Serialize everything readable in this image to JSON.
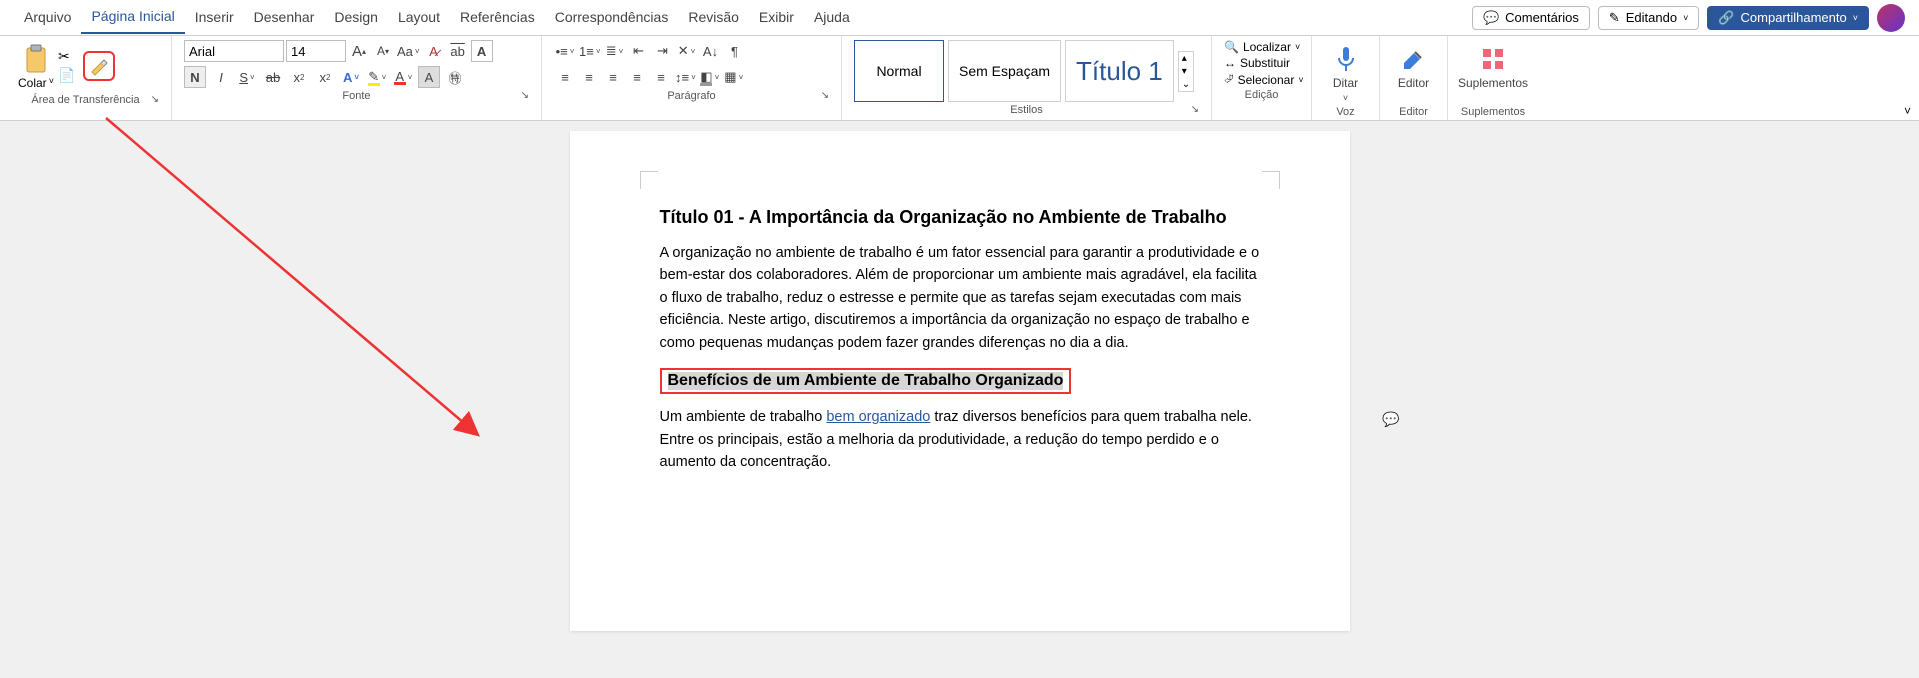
{
  "tabs": {
    "arquivo": "Arquivo",
    "inicio": "Página Inicial",
    "inserir": "Inserir",
    "desenhar": "Desenhar",
    "design": "Design",
    "layout": "Layout",
    "referencias": "Referências",
    "correspondencias": "Correspondências",
    "revisao": "Revisão",
    "exibir": "Exibir",
    "ajuda": "Ajuda"
  },
  "topright": {
    "comentarios": "Comentários",
    "editando": "Editando",
    "compartilhar": "Compartilhamento"
  },
  "groups": {
    "clipboard": "Área de Transferência",
    "font": "Fonte",
    "paragraph": "Parágrafo",
    "styles": "Estilos",
    "editing": "Edição",
    "voice": "Voz",
    "editor": "Editor",
    "addins": "Suplementos"
  },
  "clipboard": {
    "paste": "Colar"
  },
  "font": {
    "name": "Arial",
    "size": "14",
    "bold": "N",
    "italic": "I",
    "strike": "S",
    "sub": "x",
    "sup": "x"
  },
  "styles": {
    "normal": "Normal",
    "nosp": "Sem Espaçam",
    "t1": "Título 1"
  },
  "editing": {
    "find": "Localizar",
    "replace": "Substituir",
    "select": "Selecionar"
  },
  "voice": {
    "dictate": "Ditar"
  },
  "editor": {
    "label": "Editor"
  },
  "addins": {
    "label": "Suplementos"
  },
  "doc": {
    "h1": "Título 01 - A Importância da Organização no Ambiente de Trabalho",
    "p1": "A organização no ambiente de trabalho é um fator essencial para garantir a produtividade e o bem-estar dos colaboradores. Além de proporcionar um ambiente mais agradável, ela facilita o fluxo de trabalho, reduz o estresse e permite que as tarefas sejam executadas com mais eficiência. Neste artigo, discutiremos a importância da organização no espaço de trabalho e como pequenas mudanças podem fazer grandes diferenças no dia a dia.",
    "h2": "Benefícios de um Ambiente de Trabalho Organizado",
    "p2a": "Um ambiente de trabalho ",
    "p2link": "bem organizado",
    "p2b": " traz diversos benefícios para quem trabalha nele. Entre os principais, estão a melhoria da produtividade, a redução do tempo perdido e o aumento da concentração."
  }
}
